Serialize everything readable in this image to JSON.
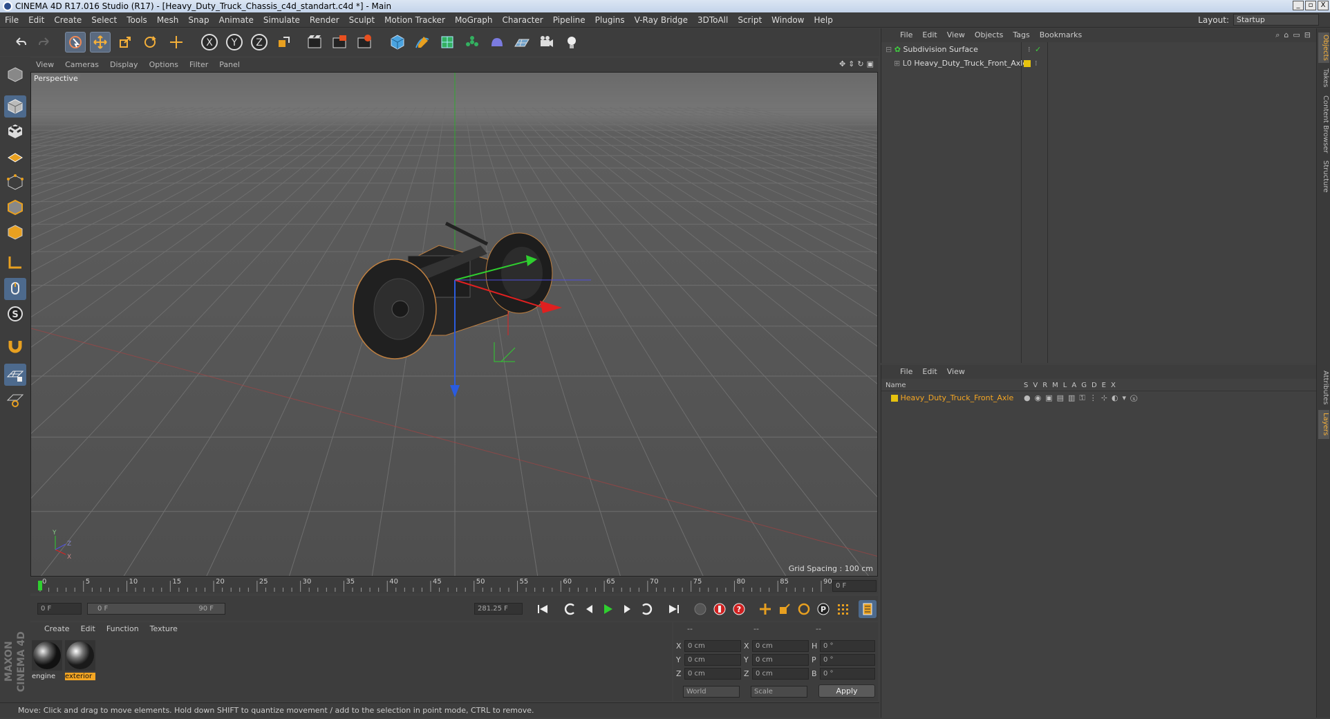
{
  "window": {
    "title": "CINEMA 4D R17.016 Studio (R17) - [Heavy_Duty_Truck_Chassis_c4d_standart.c4d *] - Main",
    "buttons": [
      "_",
      "▫",
      "X"
    ]
  },
  "menubar": {
    "items": [
      "File",
      "Edit",
      "Create",
      "Select",
      "Tools",
      "Mesh",
      "Snap",
      "Animate",
      "Simulate",
      "Render",
      "Sculpt",
      "Motion Tracker",
      "MoGraph",
      "Character",
      "Pipeline",
      "Plugins",
      "V-Ray Bridge",
      "3DToAll",
      "Script",
      "Window",
      "Help"
    ],
    "layout_label": "Layout:",
    "layout_value": "Startup"
  },
  "toolbar": {
    "icons": [
      "undo-icon",
      "redo-icon",
      "live-select-icon",
      "move-icon",
      "scale-icon",
      "rotate-icon",
      "recent-tool-icon",
      "x-axis-icon",
      "y-axis-icon",
      "z-axis-icon",
      "coordinate-system-icon",
      "render-view-icon",
      "render-picture-viewer-icon",
      "render-settings-icon",
      "cube-icon",
      "pen-spline-icon",
      "subdivision-icon",
      "array-icon",
      "deformer-icon",
      "floor-icon",
      "camera-icon",
      "light-icon"
    ],
    "axis_labels": [
      "X",
      "Y",
      "Z"
    ]
  },
  "viewport": {
    "menu": [
      "View",
      "Cameras",
      "Display",
      "Options",
      "Filter",
      "Panel"
    ],
    "label": "Perspective",
    "grid_spacing": "Grid Spacing : 100 cm",
    "axis_labels": [
      "Y",
      "Z",
      "X"
    ]
  },
  "timeline": {
    "ticks": [
      "0",
      "5",
      "10",
      "15",
      "20",
      "25",
      "30",
      "35",
      "40",
      "45",
      "50",
      "55",
      "60",
      "65",
      "70",
      "75",
      "80",
      "85",
      "90"
    ],
    "current_frame": "0 F",
    "start_field": "0 F",
    "range_start": "0 F",
    "range_end": "90 F",
    "end_field": "281.25 F"
  },
  "materials": {
    "menu": [
      "Create",
      "Edit",
      "Function",
      "Texture"
    ],
    "items": [
      {
        "name": "engine",
        "selected": false
      },
      {
        "name": "exterior",
        "selected": true
      }
    ]
  },
  "coordinates": {
    "headers": [
      "--",
      "--",
      "--"
    ],
    "rows": [
      {
        "a": "X",
        "av": "0 cm",
        "b": "X",
        "bv": "0 cm",
        "c": "H",
        "cv": "0 °"
      },
      {
        "a": "Y",
        "av": "0 cm",
        "b": "Y",
        "bv": "0 cm",
        "c": "P",
        "cv": "0 °"
      },
      {
        "a": "Z",
        "av": "0 cm",
        "b": "Z",
        "bv": "0 cm",
        "c": "B",
        "cv": "0 °"
      }
    ],
    "world": "World",
    "scale": "Scale",
    "apply": "Apply"
  },
  "status": "Move: Click and drag to move elements. Hold down SHIFT to quantize movement / add to the selection in point mode, CTRL to remove.",
  "object_manager": {
    "menu": [
      "File",
      "Edit",
      "View",
      "Objects",
      "Tags",
      "Bookmarks"
    ],
    "objects": [
      {
        "name": "Subdivision Surface"
      },
      {
        "name": "Heavy_Duty_Truck_Front_Axle"
      }
    ]
  },
  "layer_manager": {
    "menu": [
      "File",
      "Edit",
      "View"
    ],
    "header_name": "Name",
    "columns": [
      "S",
      "V",
      "R",
      "M",
      "L",
      "A",
      "G",
      "D",
      "E",
      "X"
    ],
    "layers": [
      {
        "name": "Heavy_Duty_Truck_Front_Axle",
        "color": "#e6c20e"
      }
    ]
  },
  "side_tabs": {
    "top": [
      "Objects",
      "Takes",
      "Content Browser",
      "Structure"
    ],
    "bottom": [
      "Attributes",
      "Layers"
    ]
  },
  "brand": "MAXON CINEMA 4D",
  "colors": {
    "accent": "#f5a623",
    "selection": "#e8a020",
    "layer": "#e6c20e"
  }
}
